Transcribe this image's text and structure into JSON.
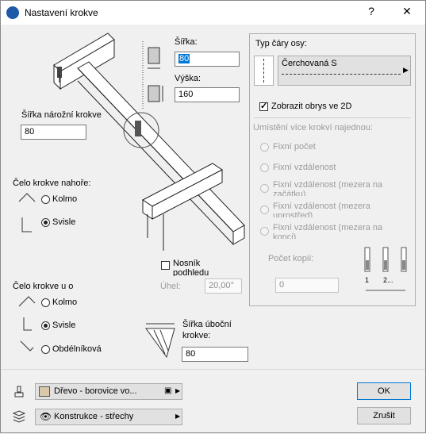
{
  "window": {
    "title": "Nastavení krokve",
    "help": "?",
    "close": "✕"
  },
  "left": {
    "corner_width_label": "Šířka nárožní krokve",
    "corner_width_value": "80",
    "head_top_label": "Čelo krokve nahoře:",
    "head_top_options": [
      "Kolmo",
      "Svisle"
    ],
    "head_bottom_label": "Čelo krokve u o",
    "head_bottom_options": [
      "Kolmo",
      "Svisle",
      "Obdélníková"
    ]
  },
  "center": {
    "width_label": "Šířka:",
    "width_value": "80",
    "height_label": "Výška:",
    "height_value": "160",
    "soffit_label": "Nosník podhledu",
    "angle_label": "Úhel:",
    "angle_value": "20,00°",
    "valley_width_label": "Šířka úboční krokve:",
    "valley_width_value": "80"
  },
  "right": {
    "axis_line_label": "Typ čáry osy:",
    "axis_line_value": "Čerchovaná S",
    "show_outline_label": "Zobrazit obrys ve 2D",
    "multi_label": "Umístění více krokví najednou:",
    "multi_options": [
      "Fixní počet",
      "Fixní vzdálenost",
      "Fixní vzdálenost (mezera na začátku)",
      "Fixní vzdálenost (mezera uprostřed)",
      "Fixní vzdálenost (mezera na konci)"
    ],
    "copies_label": "Počet kopií:",
    "copies_value": "0",
    "diagram_labels": [
      "1",
      "2..."
    ]
  },
  "footer": {
    "material_value": "Dřevo - borovice vo...",
    "layer_value": "Konstrukce - střechy",
    "ok_label": "OK",
    "cancel_label": "Zrušit"
  },
  "colors": {
    "material_swatch": "#d9c9aa",
    "accent": "#0078d7"
  }
}
